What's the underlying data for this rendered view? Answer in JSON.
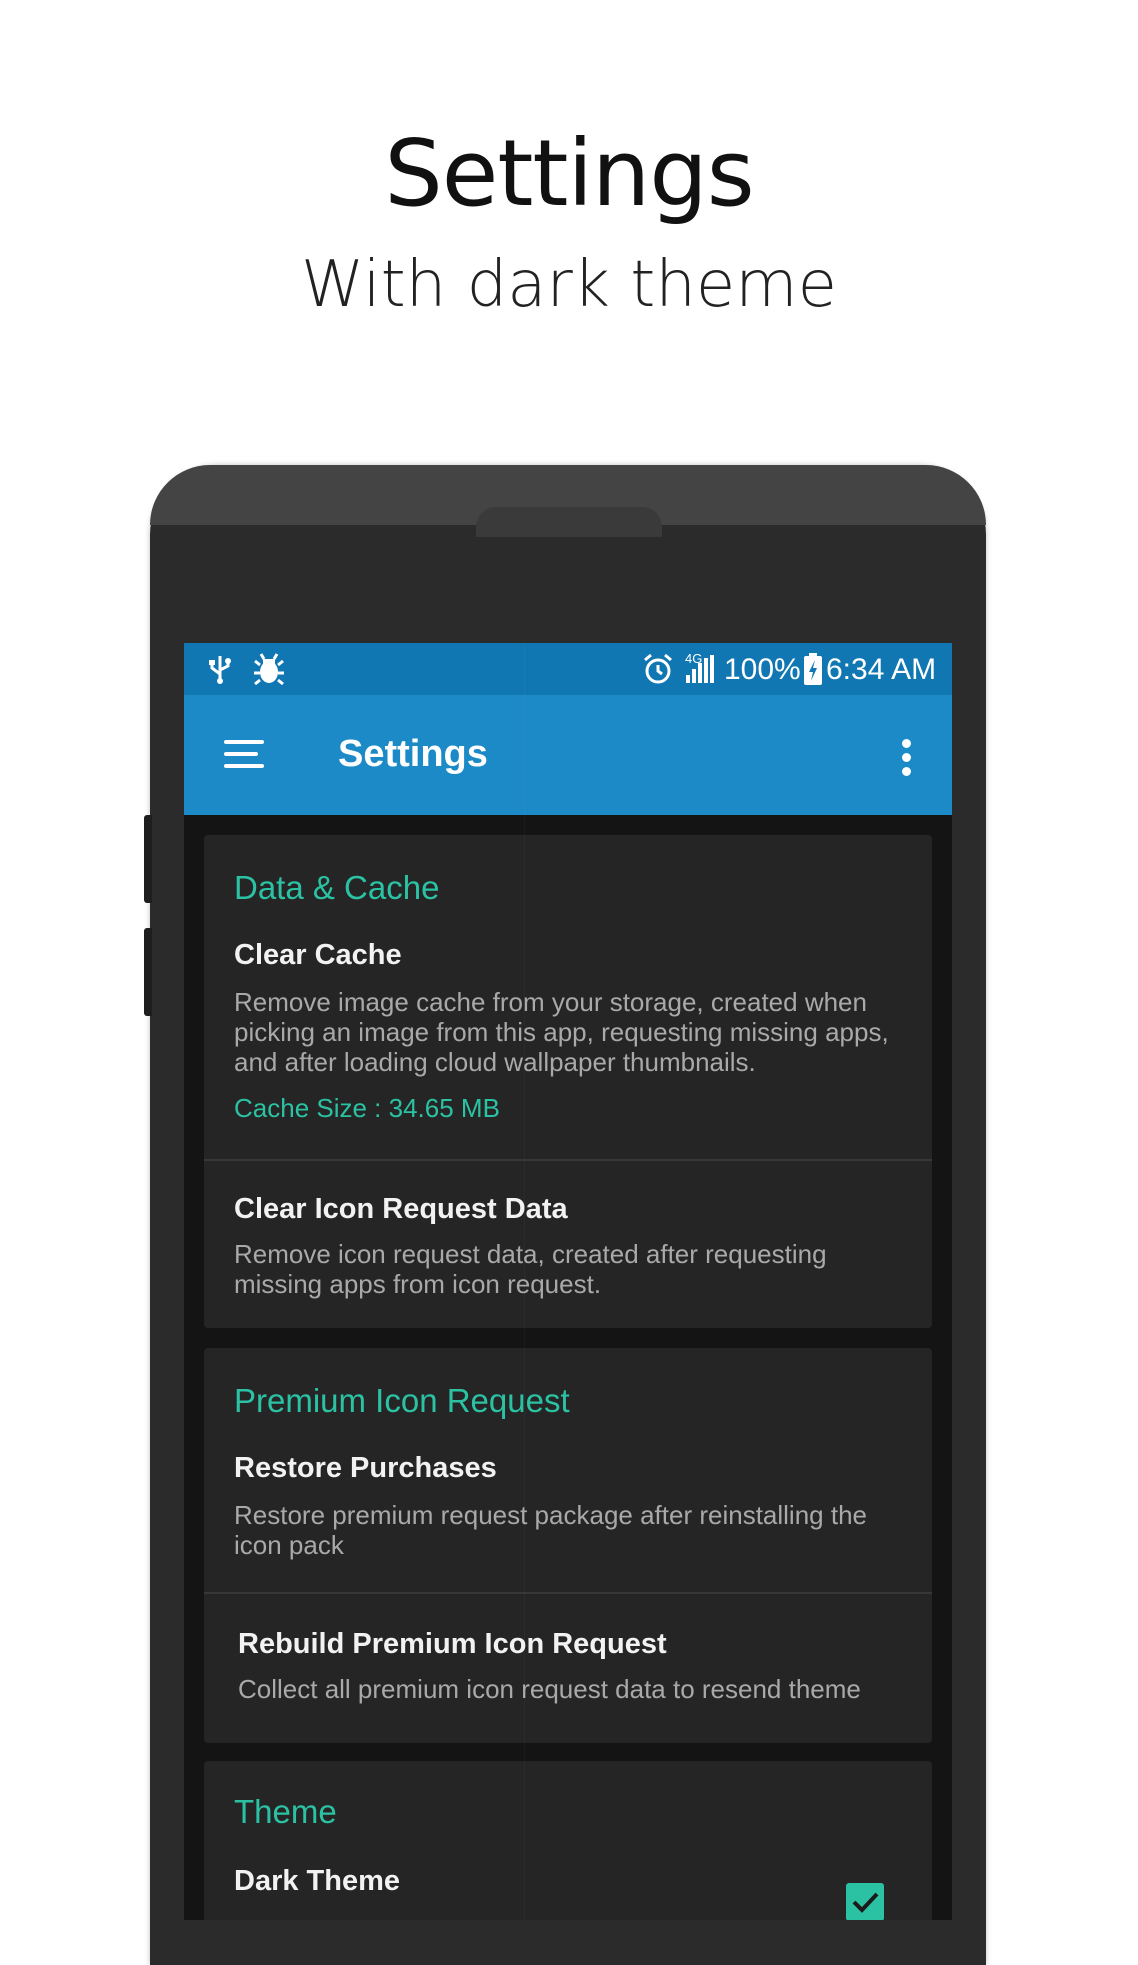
{
  "hero": {
    "title": "Settings",
    "subtitle": "With dark theme"
  },
  "status_bar": {
    "left_icons": [
      "usb-icon",
      "debug-bug-icon"
    ],
    "battery": "100%",
    "time": "6:34 AM",
    "network": "4G",
    "right_icons": [
      "alarm-icon",
      "signal-icon",
      "battery-charging-icon"
    ]
  },
  "toolbar": {
    "title": "Settings",
    "menu_icon": "hamburger-menu-icon",
    "overflow_icon": "more-vert-icon"
  },
  "sections": {
    "data_cache": {
      "title": "Data & Cache",
      "clear_cache": {
        "title": "Clear Cache",
        "description": "Remove image cache from your storage, created when picking an image from this app, requesting missing apps, and after loading cloud wallpaper thumbnails.",
        "extra": "Cache Size : 34.65 MB"
      },
      "clear_icon_request": {
        "title": "Clear Icon Request Data",
        "description": "Remove icon request data, created after requesting missing apps from icon request."
      }
    },
    "premium": {
      "title": "Premium Icon Request",
      "restore": {
        "title": "Restore Purchases",
        "description": "Restore premium request package after reinstalling the icon pack"
      },
      "rebuild": {
        "title": "Rebuild Premium Icon Request",
        "description": "Collect all premium icon request data to resend theme"
      }
    },
    "theme": {
      "title": "Theme",
      "dark_theme": {
        "title": "Dark Theme",
        "checked": true
      }
    }
  },
  "colors": {
    "accent": "#2bc2a4",
    "toolbar": "#1b8ac6",
    "statusbar": "#1177b3",
    "card": "#252525",
    "background": "#141414"
  }
}
